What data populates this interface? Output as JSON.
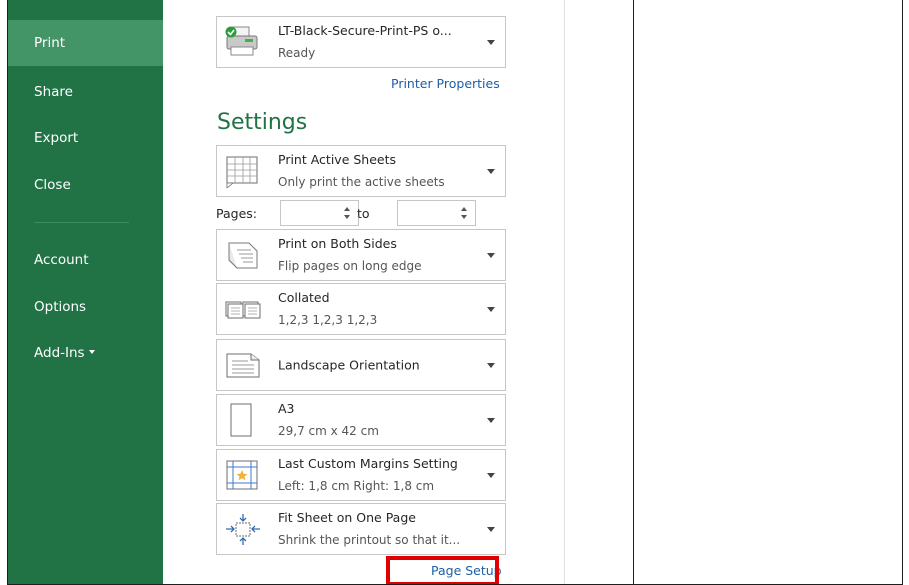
{
  "nav": {
    "items": [
      "Print",
      "Share",
      "Export",
      "Close",
      "Account",
      "Options",
      "Add-Ins"
    ]
  },
  "printer": {
    "name": "LT-Black-Secure-Print-PS o...",
    "status": "Ready",
    "properties_link": "Printer Properties"
  },
  "settings": {
    "title": "Settings",
    "print_what": {
      "title": "Print Active Sheets",
      "subtitle": "Only print the active sheets"
    },
    "pages": {
      "label": "Pages:",
      "to_label": "to",
      "from_value": "",
      "to_value": ""
    },
    "sides": {
      "title": "Print on Both Sides",
      "subtitle": "Flip pages on long edge"
    },
    "collation": {
      "title": "Collated",
      "subtitle": "1,2,3   1,2,3   1,2,3"
    },
    "orientation": {
      "title": "Landscape Orientation"
    },
    "paper": {
      "title": "A3",
      "subtitle": "29,7 cm x 42 cm"
    },
    "margins": {
      "title": "Last Custom Margins Setting",
      "subtitle": "Left:  1,8 cm    Right:  1,8 cm"
    },
    "scaling": {
      "title": "Fit Sheet on One Page",
      "subtitle": "Shrink the printout so that it..."
    },
    "page_setup_link": "Page Setup"
  },
  "colors": {
    "nav_bg": "#217346",
    "nav_active": "#439467",
    "link": "#1e5ea8",
    "highlight": "#e00000"
  }
}
